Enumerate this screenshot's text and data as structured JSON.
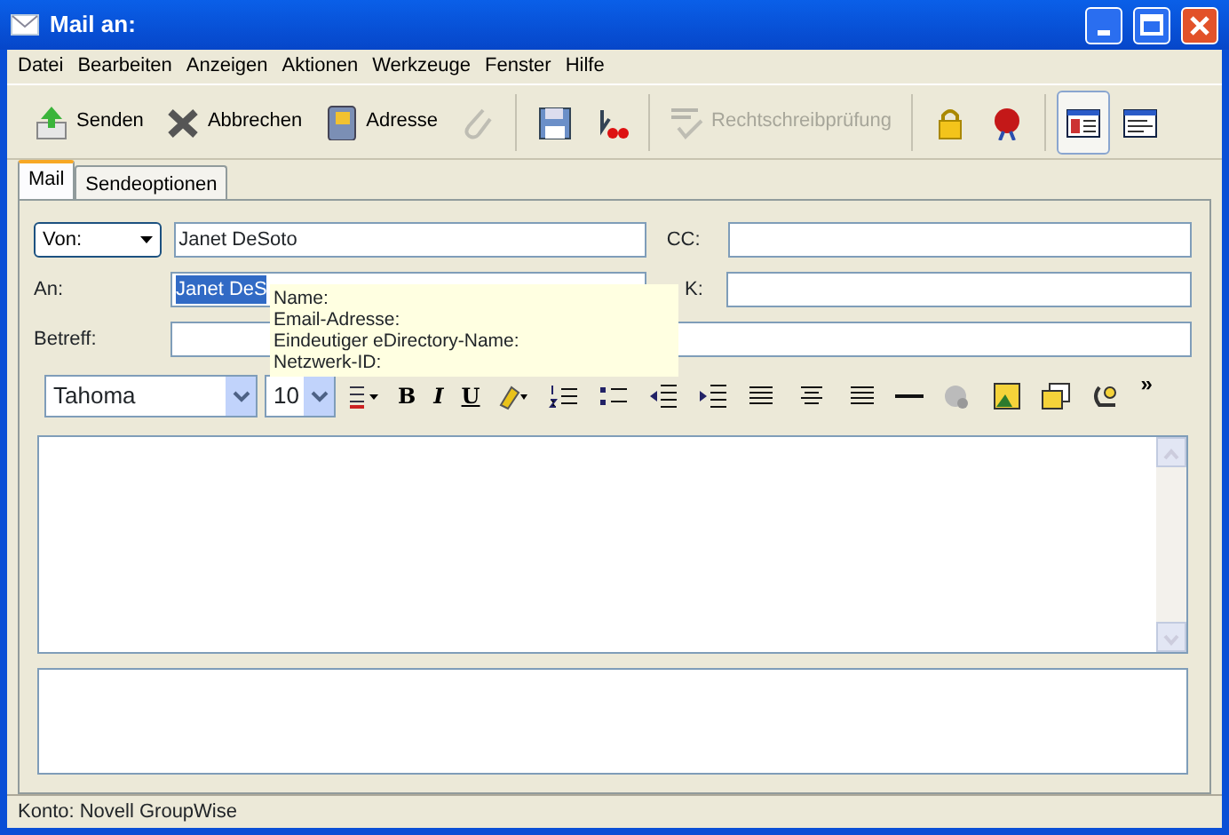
{
  "window": {
    "title": "Mail an:"
  },
  "menu": [
    "Datei",
    "Bearbeiten",
    "Anzeigen",
    "Aktionen",
    "Werkzeuge",
    "Fenster",
    "Hilfe"
  ],
  "toolbar": [
    {
      "kind": "labeled",
      "label": "Senden",
      "disabled": false
    },
    {
      "kind": "labeled",
      "label": "Abbrechen",
      "disabled": false
    },
    {
      "kind": "labeled",
      "label": "Adresse",
      "disabled": false
    },
    {
      "kind": "icon",
      "disabled": true
    },
    {
      "kind": "separator"
    },
    {
      "kind": "icon",
      "disabled": false
    },
    {
      "kind": "icon",
      "disabled": false
    },
    {
      "kind": "separator"
    },
    {
      "kind": "labeled",
      "label": "Rechtschreibprüfung",
      "disabled": true
    },
    {
      "kind": "separator"
    },
    {
      "kind": "icon",
      "disabled": false
    },
    {
      "kind": "icon",
      "disabled": false
    },
    {
      "kind": "separator"
    },
    {
      "kind": "toggle",
      "selected": true
    },
    {
      "kind": "toggle",
      "selected": false
    }
  ],
  "tabs": [
    {
      "label": "Mail",
      "selected": true
    },
    {
      "label": "Sendeoptionen",
      "selected": false
    }
  ],
  "from": {
    "label": "Von:",
    "value": "Janet DeSoto"
  },
  "cc": {
    "label": "CC:"
  },
  "to": {
    "label": "An:",
    "value": "Janet DeS",
    "highlighted": true
  },
  "bc": {
    "label": "K:"
  },
  "subject": {
    "label": "Betreff:"
  },
  "tooltip": [
    "Name:",
    "Email-Adresse:",
    "Eindeutiger eDirectory-Name:",
    "Netzwerk-ID:"
  ],
  "format": {
    "font": "Tahoma",
    "size": "10",
    "bold": "B",
    "italic": "I",
    "underline": "U",
    "more": "»"
  },
  "status_bar": "Konto: Novell GroupWise"
}
